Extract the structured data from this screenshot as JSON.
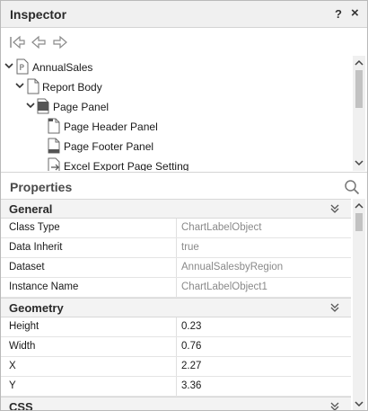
{
  "window": {
    "title": "Inspector",
    "help_label": "?",
    "close_label": "×"
  },
  "tree": {
    "items": [
      {
        "label": "AnnualSales",
        "icon": "report-icon",
        "expanded": true
      },
      {
        "label": "Report Body",
        "icon": "page-icon",
        "expanded": true
      },
      {
        "label": "Page Panel",
        "icon": "panel-icon",
        "expanded": true
      },
      {
        "label": "Page Header Panel",
        "icon": "page-header-icon"
      },
      {
        "label": "Page Footer Panel",
        "icon": "page-footer-icon"
      },
      {
        "label": "Excel Export Page Setting",
        "icon": "export-setting-icon"
      }
    ]
  },
  "properties": {
    "title": "Properties",
    "sections": [
      {
        "name": "General",
        "rows": [
          {
            "key": "Class Type",
            "value": "ChartLabelObject",
            "editable": false
          },
          {
            "key": "Data Inherit",
            "value": "true",
            "editable": false
          },
          {
            "key": "Dataset",
            "value": "AnnualSalesbyRegion",
            "editable": false
          },
          {
            "key": "Instance Name",
            "value": "ChartLabelObject1",
            "editable": false
          }
        ]
      },
      {
        "name": "Geometry",
        "rows": [
          {
            "key": "Height",
            "value": "0.23",
            "editable": true
          },
          {
            "key": "Width",
            "value": "0.76",
            "editable": true
          },
          {
            "key": "X",
            "value": "2.27",
            "editable": true
          },
          {
            "key": "Y",
            "value": "3.36",
            "editable": true
          }
        ]
      },
      {
        "name": "CSS",
        "rows": []
      }
    ]
  }
}
